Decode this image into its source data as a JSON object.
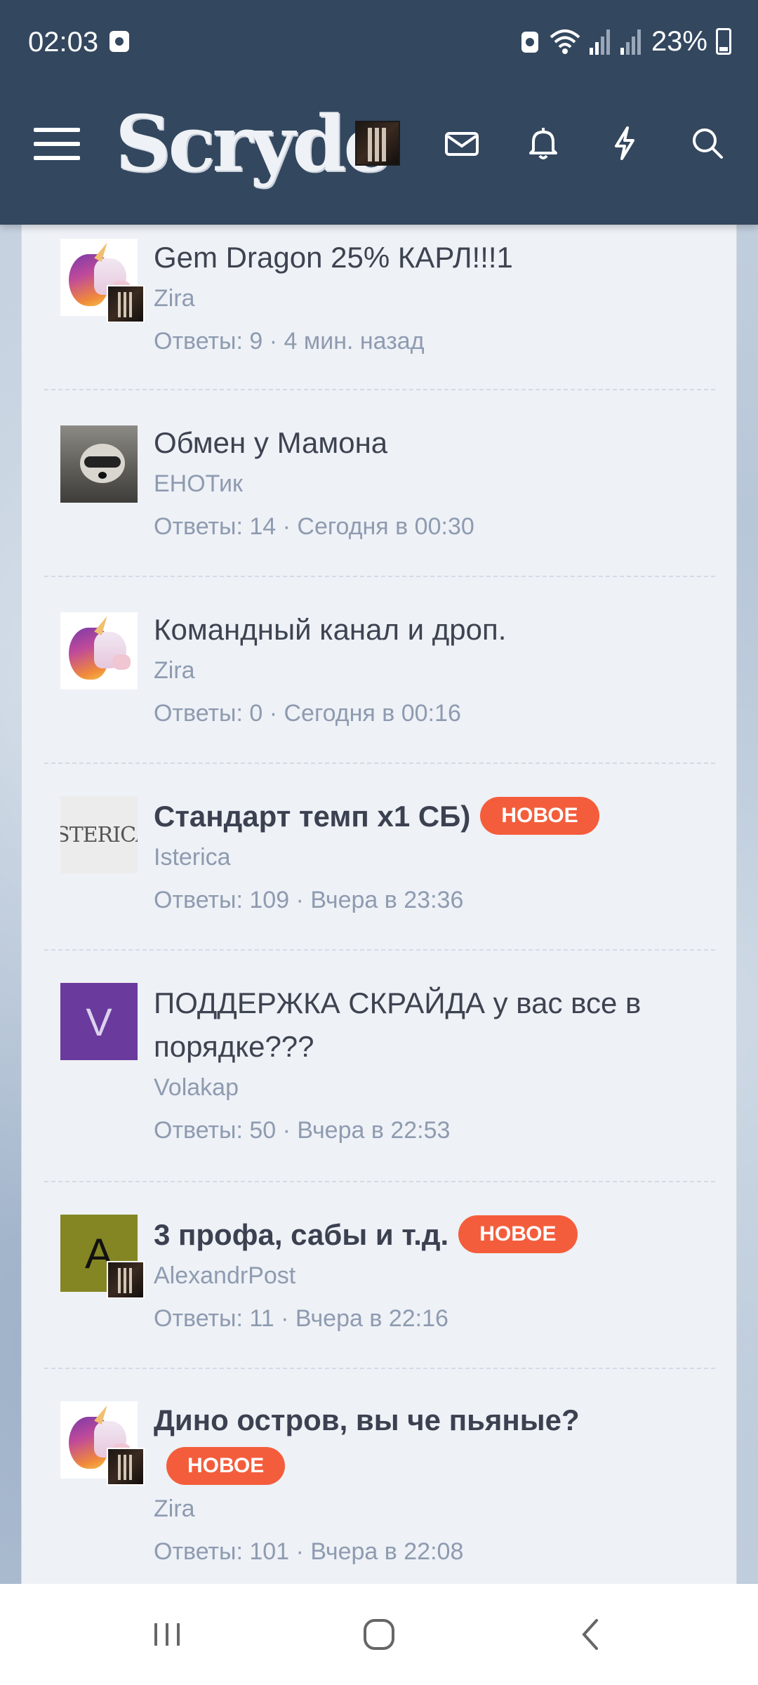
{
  "status_bar": {
    "time": "02:03",
    "battery": "23%"
  },
  "header": {
    "logo": "Scryde",
    "icons": [
      "menu-icon",
      "mail-icon",
      "bell-icon",
      "lightning-icon",
      "search-icon"
    ]
  },
  "threads": [
    {
      "title": "Gem Dragon 25% КАРЛ!!!1",
      "author": "Zira",
      "meta": "Ответы: 9 · 4 мин. назад",
      "unread": false
    },
    {
      "title": "Обмен у Мамона",
      "author": "ЕНОТик",
      "meta": "Ответы: 14 · Сегодня в 00:30",
      "unread": false
    },
    {
      "title": "Командный канал и дроп.",
      "author": "Zira",
      "meta": "Ответы: 0 · Сегодня в 00:16",
      "unread": false
    },
    {
      "title": "Стандарт темп х1 СБ)",
      "badge": "НОВОЕ",
      "author": "Isterica",
      "avatar_text": "ISTERICA",
      "meta": "Ответы: 109 · Вчера в 23:36",
      "unread": true
    },
    {
      "title": "ПОДДЕРЖКА СКРАЙДА у вас все в порядке???",
      "author": "Volakap",
      "avatar_letter": "V",
      "avatar_color": "#6a3a9c",
      "meta": "Ответы: 50 · Вчера в 22:53",
      "unread": false
    },
    {
      "title": "3 профа, сабы и т.д.",
      "badge": "НОВОЕ",
      "author": "AlexandrPost",
      "avatar_letter": "A",
      "avatar_color": "#848624",
      "meta": "Ответы: 11 · Вчера в 22:16",
      "unread": true
    },
    {
      "title": "Дино остров, вы че пьяные?",
      "badge": "НОВОЕ",
      "author": "Zira",
      "meta": "Ответы: 101 · Вчера в 22:08",
      "unread": true
    }
  ],
  "colors": {
    "header_bg": "#33475f",
    "badge_new": "#f45d3c",
    "card_bg": "#eef1f6"
  },
  "bottom_nav": [
    "recent-apps-icon",
    "home-icon",
    "back-icon"
  ]
}
